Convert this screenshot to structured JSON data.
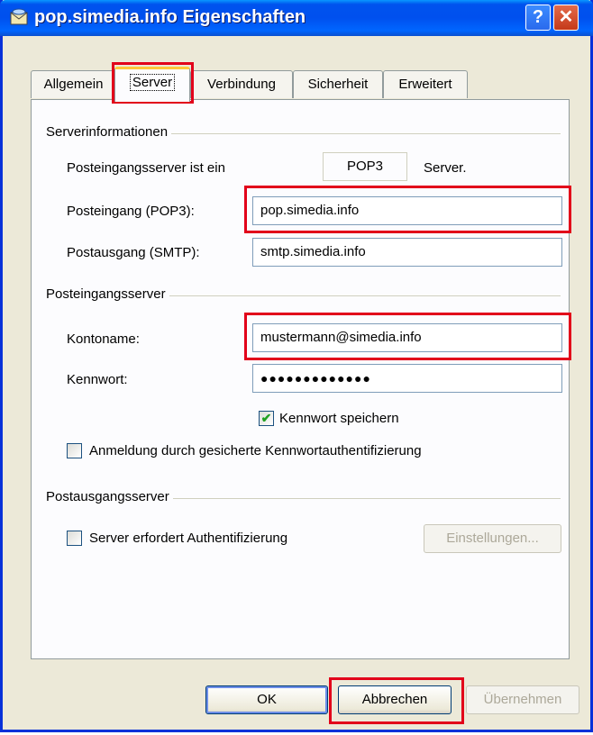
{
  "window": {
    "title": "pop.simedia.info Eigenschaften",
    "help_glyph": "?",
    "close_glyph": "✕"
  },
  "tabs": [
    {
      "label": "Allgemein"
    },
    {
      "label": "Server"
    },
    {
      "label": "Verbindung"
    },
    {
      "label": "Sicherheit"
    },
    {
      "label": "Erweitert"
    }
  ],
  "server_info": {
    "group_label": "Serverinformationen",
    "server_type_label": "Posteingangsserver ist ein",
    "server_type_value": "POP3",
    "server_type_suffix": "Server.",
    "pop3_label": "Posteingang (POP3):",
    "pop3_value": "pop.simedia.info",
    "smtp_label": "Postausgang (SMTP):",
    "smtp_value": "smtp.simedia.info"
  },
  "incoming": {
    "group_label": "Posteingangsserver",
    "account_label": "Kontoname:",
    "account_value": "mustermann@simedia.info",
    "password_label": "Kennwort:",
    "password_value": "●●●●●●●●●●●●●",
    "save_password_label": "Kennwort speichern",
    "save_password_checked": true,
    "spa_label": "Anmeldung durch gesicherte Kennwortauthentifizierung",
    "spa_checked": false
  },
  "outgoing": {
    "group_label": "Postausgangsserver",
    "auth_label": "Server erfordert Authentifizierung",
    "auth_checked": false,
    "settings_button": "Einstellungen..."
  },
  "buttons": {
    "ok": "OK",
    "cancel": "Abbrechen",
    "apply": "Übernehmen"
  },
  "colors": {
    "highlight": "#e2001a",
    "titlebar": "#0054e3"
  }
}
